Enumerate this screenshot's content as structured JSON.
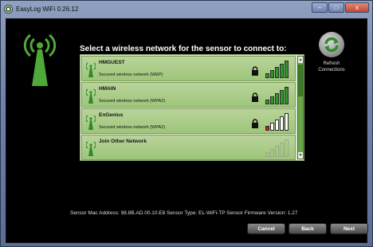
{
  "window": {
    "title": "EasyLog WiFi 0.26.12",
    "controls": [
      "–",
      "□",
      "x"
    ]
  },
  "main": {
    "headline": "Select a wireless network for the sensor to connect to:",
    "networks": [
      {
        "name": "HMGUEST",
        "security": "Secured wireless network (WEP)",
        "signal_bars": 5,
        "locked": true,
        "signal_color": "#2f9a2a"
      },
      {
        "name": "HMAIN",
        "security": "Secured wireless network (WPA2)",
        "signal_bars": 5,
        "locked": true,
        "signal_color": "#2f9a2a"
      },
      {
        "name": "EnGenius",
        "security": "Secured wireless network (WPA2)",
        "signal_bars": 1,
        "locked": true,
        "signal_color": "#d01a1a"
      },
      {
        "name": "Join Other Network",
        "security": "",
        "signal_bars": 0,
        "locked": false,
        "signal_color": "#2f9a2a"
      }
    ]
  },
  "refresh": {
    "label_line1": "Refresh",
    "label_line2": "Connections",
    "icon": "refresh-arrows-icon"
  },
  "sensor_info": "Sensor Mac Address: 98.8B.AD.00.10.E8  Sensor Type: EL-WiFi-TP  Sensor Firmware Version: 1.27",
  "buttons": {
    "cancel": "Cancel",
    "back": "Back",
    "next": "Next"
  }
}
